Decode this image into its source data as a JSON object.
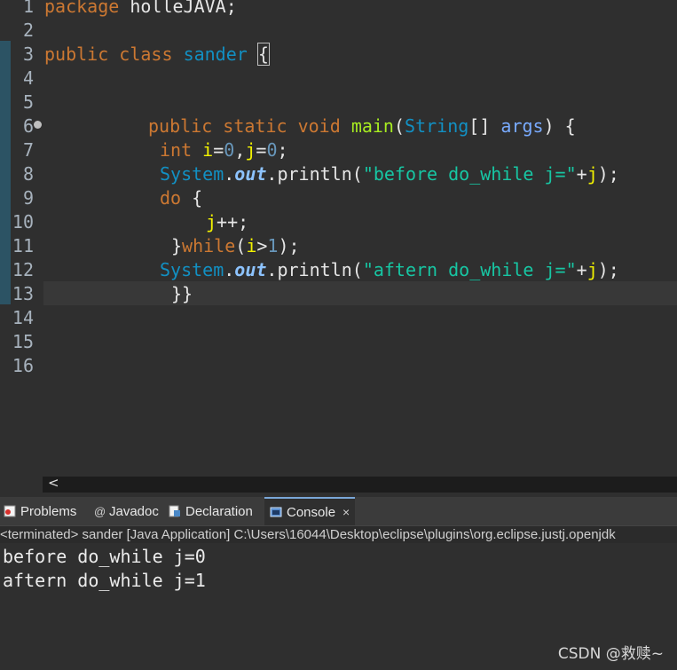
{
  "editor": {
    "line_numbers": [
      "1",
      "2",
      "3",
      "4",
      "5",
      "6",
      "7",
      "8",
      "9",
      "10",
      "11",
      "12",
      "13",
      "14",
      "15",
      "16"
    ],
    "line1": {
      "kw": "package",
      "rest": " holleJAVA;"
    },
    "line3": {
      "kw1": "public",
      "kw2": "class",
      "name": "sander",
      "brace": "{"
    },
    "line6": {
      "kw1": "public",
      "kw2": "static",
      "kw3": "void",
      "method": "main",
      "paren_open": "(",
      "type": "String",
      "arr": "[]",
      "param": "args",
      "paren_close": ")",
      "brace": " {"
    },
    "line7": {
      "kw": "int",
      "v1": "i",
      "eq1": "=",
      "n1": "0",
      "comma": ",",
      "v2": "j",
      "eq2": "=",
      "n2": "0",
      "semi": ";"
    },
    "line8": {
      "cls": "System",
      "dot1": ".",
      "field": "out",
      "dot2": ".",
      "method": "println",
      "open": "(",
      "str": "\"before do_while j=\"",
      "plus": "+",
      "var": "j",
      "close": ");"
    },
    "line9": {
      "kw": "do",
      "brace": " {"
    },
    "line10": {
      "var": "j",
      "op": "++;"
    },
    "line11": {
      "brace": "}",
      "kw": "while",
      "open": "(",
      "var": "i",
      "gt": ">",
      "num": "1",
      "close": ");"
    },
    "line12": {
      "cls": "System",
      "dot1": ".",
      "field": "out",
      "dot2": ".",
      "method": "println",
      "open": "(",
      "str": "\"aftern do_while j=\"",
      "plus": "+",
      "var": "j",
      "close": ");"
    },
    "line13": {
      "text": "}}"
    }
  },
  "hscroll": {
    "arrow": "<"
  },
  "tabs": [
    {
      "label": "Problems",
      "icon": "problems-icon"
    },
    {
      "label": "Javadoc",
      "icon": "javadoc-icon"
    },
    {
      "label": "Declaration",
      "icon": "declaration-icon"
    },
    {
      "label": "Console",
      "icon": "console-icon",
      "active": true
    }
  ],
  "tab_close": "×",
  "console": {
    "status": "<terminated> sander [Java Application] C:\\Users\\16044\\Desktop\\eclipse\\plugins\\org.eclipse.justj.openjdk",
    "output": [
      "before do_while j=0",
      "aftern do_while j=1"
    ]
  },
  "watermark": "CSDN @救赎~"
}
